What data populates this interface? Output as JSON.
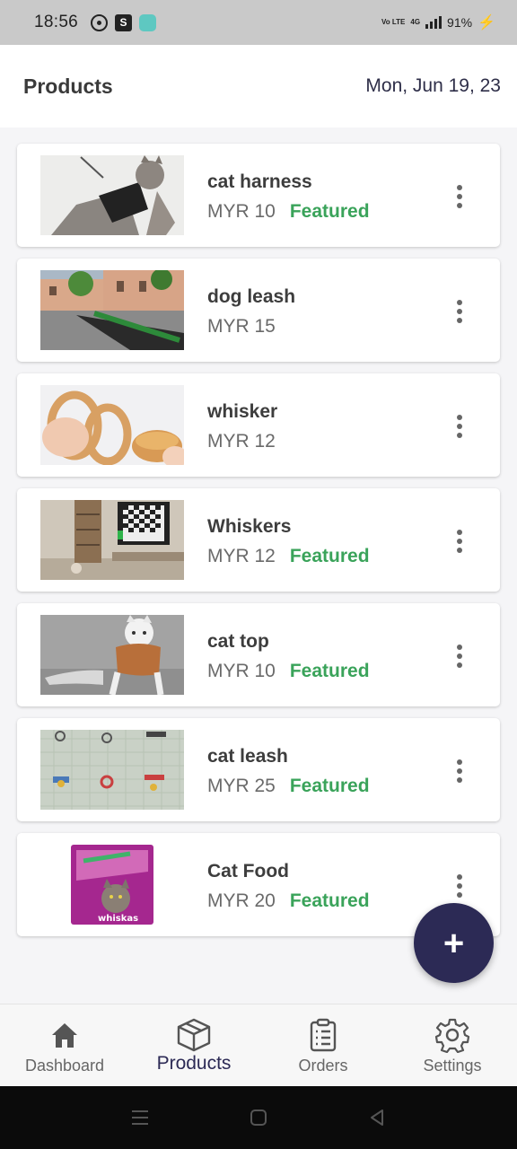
{
  "status_bar": {
    "time": "18:56",
    "volte": "Vo LTE",
    "network": "4G",
    "battery": "91%"
  },
  "header": {
    "title": "Products",
    "date": "Mon, Jun 19, 23"
  },
  "products": [
    {
      "name": "cat harness",
      "price": "MYR 10",
      "badge": "Featured",
      "image": "cat-in-harness"
    },
    {
      "name": "dog leash",
      "price": "MYR 15",
      "badge": "",
      "image": "street-with-bicycles"
    },
    {
      "name": "whisker",
      "price": "MYR 12",
      "badge": "",
      "image": "hands-with-bread"
    },
    {
      "name": "Whiskers",
      "price": "MYR 12",
      "badge": "Featured",
      "image": "living-room-tv"
    },
    {
      "name": "cat top",
      "price": "MYR 10",
      "badge": "Featured",
      "image": "cat-in-sweater"
    },
    {
      "name": "cat leash",
      "price": "MYR 25",
      "badge": "Featured",
      "image": "collar-pattern-fabric"
    },
    {
      "name": "Cat Food",
      "price": "MYR 20",
      "badge": "Featured",
      "image": "whiskas-food-bag",
      "brand_text": "whiskas"
    }
  ],
  "fab": {
    "icon": "plus-icon",
    "label": "+"
  },
  "bottom_nav": [
    {
      "label": "Dashboard",
      "icon": "home-icon",
      "active": false
    },
    {
      "label": "Products",
      "icon": "box-icon",
      "active": true
    },
    {
      "label": "Orders",
      "icon": "clipboard-icon",
      "active": false
    },
    {
      "label": "Settings",
      "icon": "gear-icon",
      "active": false
    }
  ],
  "colors": {
    "primary": "#2c2a55",
    "featured": "#3aa35a",
    "background": "#f5f5f7"
  }
}
